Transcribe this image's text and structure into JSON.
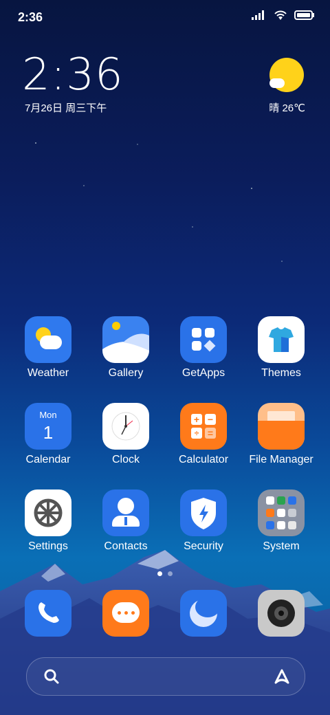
{
  "status_bar": {
    "time": "2:36"
  },
  "lockscreen": {
    "clock": "2:36",
    "date": "7月26日 周三下午",
    "weather": "晴 26℃"
  },
  "apps": [
    {
      "label": "Weather",
      "icon": "weather-icon"
    },
    {
      "label": "Gallery",
      "icon": "gallery-icon"
    },
    {
      "label": "GetApps",
      "icon": "getapps-icon"
    },
    {
      "label": "Themes",
      "icon": "themes-icon"
    },
    {
      "label": "Calendar",
      "icon": "calendar-icon",
      "day": "Mon",
      "date": "1"
    },
    {
      "label": "Clock",
      "icon": "clock-icon"
    },
    {
      "label": "Calculator",
      "icon": "calculator-icon"
    },
    {
      "label": "File Manager",
      "icon": "file-manager-icon"
    },
    {
      "label": "Settings",
      "icon": "settings-icon"
    },
    {
      "label": "Contacts",
      "icon": "contacts-icon"
    },
    {
      "label": "Security",
      "icon": "security-icon"
    },
    {
      "label": "System",
      "icon": "system-folder-icon"
    }
  ],
  "dock": [
    {
      "icon": "phone-icon"
    },
    {
      "icon": "messaging-icon"
    },
    {
      "icon": "browser-icon"
    },
    {
      "icon": "camera-icon"
    }
  ],
  "page_indicator": {
    "pages": 2,
    "current": 1
  },
  "colors": {
    "blue_icon": "#2a72e8",
    "orange_icon": "#ff7a1a",
    "sun": "#ffd21a"
  }
}
